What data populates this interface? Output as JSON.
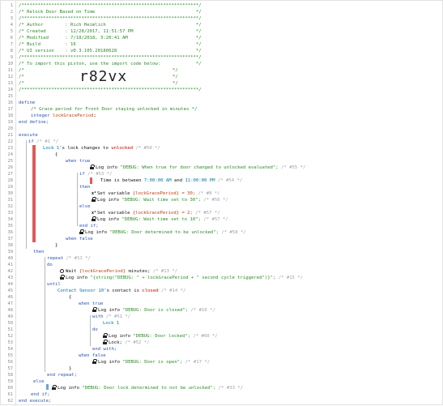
{
  "line_numbers": [
    "1",
    "2",
    "3",
    "4",
    "5",
    "6",
    "7",
    "8",
    "9",
    "10",
    "11",
    "12",
    "13",
    "14",
    "15",
    "16",
    "17",
    "18",
    "19",
    "20",
    "21",
    "22",
    "23",
    "24",
    "25",
    "26",
    "27",
    "28",
    "29",
    "30",
    "31",
    "32",
    "33",
    "34",
    "35",
    "36",
    "37",
    "38",
    "39",
    "40",
    "41",
    "42",
    "43",
    "44",
    "45",
    "46",
    "47",
    "48",
    "49",
    "50",
    "51",
    "52",
    "53",
    "54",
    "55",
    "56",
    "57",
    "58",
    "59",
    "60",
    "61",
    "62"
  ],
  "code": {
    "l1": "/*****************************************************************/",
    "l2": "/* Relock Door Based on Time                                     */",
    "l3": "/*****************************************************************/",
    "l4": "/* Author        : Rich Heimlich                                 */",
    "l5": "/* Created       : 12/28/2017, 11:51:57 PM                       */",
    "l6": "/* Modified      : 7/18/2018, 3:20:41 AM                         */",
    "l7": "/* Build         : 16                                            */",
    "l8": "/* UI version    : v0.3.105.20180628                             */",
    "l9": "/*****************************************************************/",
    "l10": "/* To import this piston, use the import code below:             */",
    "l11a": "/*",
    "l11b": "*/",
    "import_code": "r82vx",
    "l12a": "/*",
    "l12b": "*/",
    "l13a": "/*",
    "l13b": "*/",
    "l14": "/*****************************************************************/",
    "define": "define",
    "grace_comment": "/* Grace period for Front Door staying unlocked in minutes */",
    "integer": "integer",
    "lockGracePeriod": "lockGracePeriod",
    "end_define": "end define;",
    "execute": "execute",
    "if": "if",
    "if_id": "/* #1 */",
    "lock1": "Lock 1",
    "lock_changes": "'s lock changes to",
    "unlocked": "unlocked",
    "id50": "/* #50 */",
    "brace_open": "{",
    "brace_close": "}",
    "when_true": "when true",
    "log_info": "Log info",
    "log_when_true": "\"DEBUG: When true for door changed to unlocked evaluated\";",
    "id55": "/* #55 */",
    "if_inner": "if",
    "id53": "/* #53 */",
    "time_is_between": "Time is between",
    "t1": "7:00:00 AM",
    "and": "and",
    "t2": "11:00:00 PM",
    "id54": "/* #54 */",
    "then": "then",
    "set_variable": "Set variable",
    "set_30": "{lockGracePeriod} = 30;",
    "id8": "/* #8 */",
    "log_wait_30": "\"DEBUG: Wait time set to 30\";",
    "id56": "/* #56 */",
    "else": "else",
    "set_2": "{lockGracePeriod} = 2;",
    "id57": "/* #57 */",
    "log_wait_10": "\"DEBUG: Wait time set to 10\";",
    "id57b": "/* #57 */",
    "end_if": "end if;",
    "log_door_unlocked": "\"DEBUG: Door determined to be unlocked\";",
    "id58": "/* #58 */",
    "when_false": "when false",
    "repeat": "repeat",
    "id11": "/* #11 */",
    "do": "do",
    "wait": "Wait",
    "wait_arg": "{lockGracePeriod}",
    "minutes": "minutes;",
    "id13": "/* #13 */",
    "log_string": "\"{string(\"DEBUG: \" + lockGracePeriod + \" second cycle triggered\")}\";",
    "id15": "/* #15 */",
    "until": "until",
    "contact": "Contact Sensor 10",
    "contact_is": "'s contact is",
    "closed": "closed",
    "id14": "/* #14 */",
    "log_closed": "\"DEBUG: Door is closed\";",
    "id16": "/* #16 */",
    "with": "with",
    "id51": "/* #51 */",
    "lock_1": "Lock 1",
    "log_locked": "\"DEBUG: Door locked\";",
    "id60": "/* #60 */",
    "lock_cmd": "Lock;",
    "id52": "/* #52 */",
    "end_with": "end with;",
    "log_open": "\"DEBUG: Door is open\";",
    "id17": "/* #17 */",
    "end_repeat": "end repeat;",
    "log_not_unlocked": "\"DEBUG: Door lock determined to not be unlocked\";",
    "id33": "/* #33 */",
    "end_execute": "end execute;"
  },
  "colors": {
    "comment": "#2d8a2d",
    "keyword": "#2a55b3",
    "device": "#0078a8",
    "variable": "#c2410c",
    "red_bar": "#e05a5a",
    "green_bar": "#46a846"
  }
}
